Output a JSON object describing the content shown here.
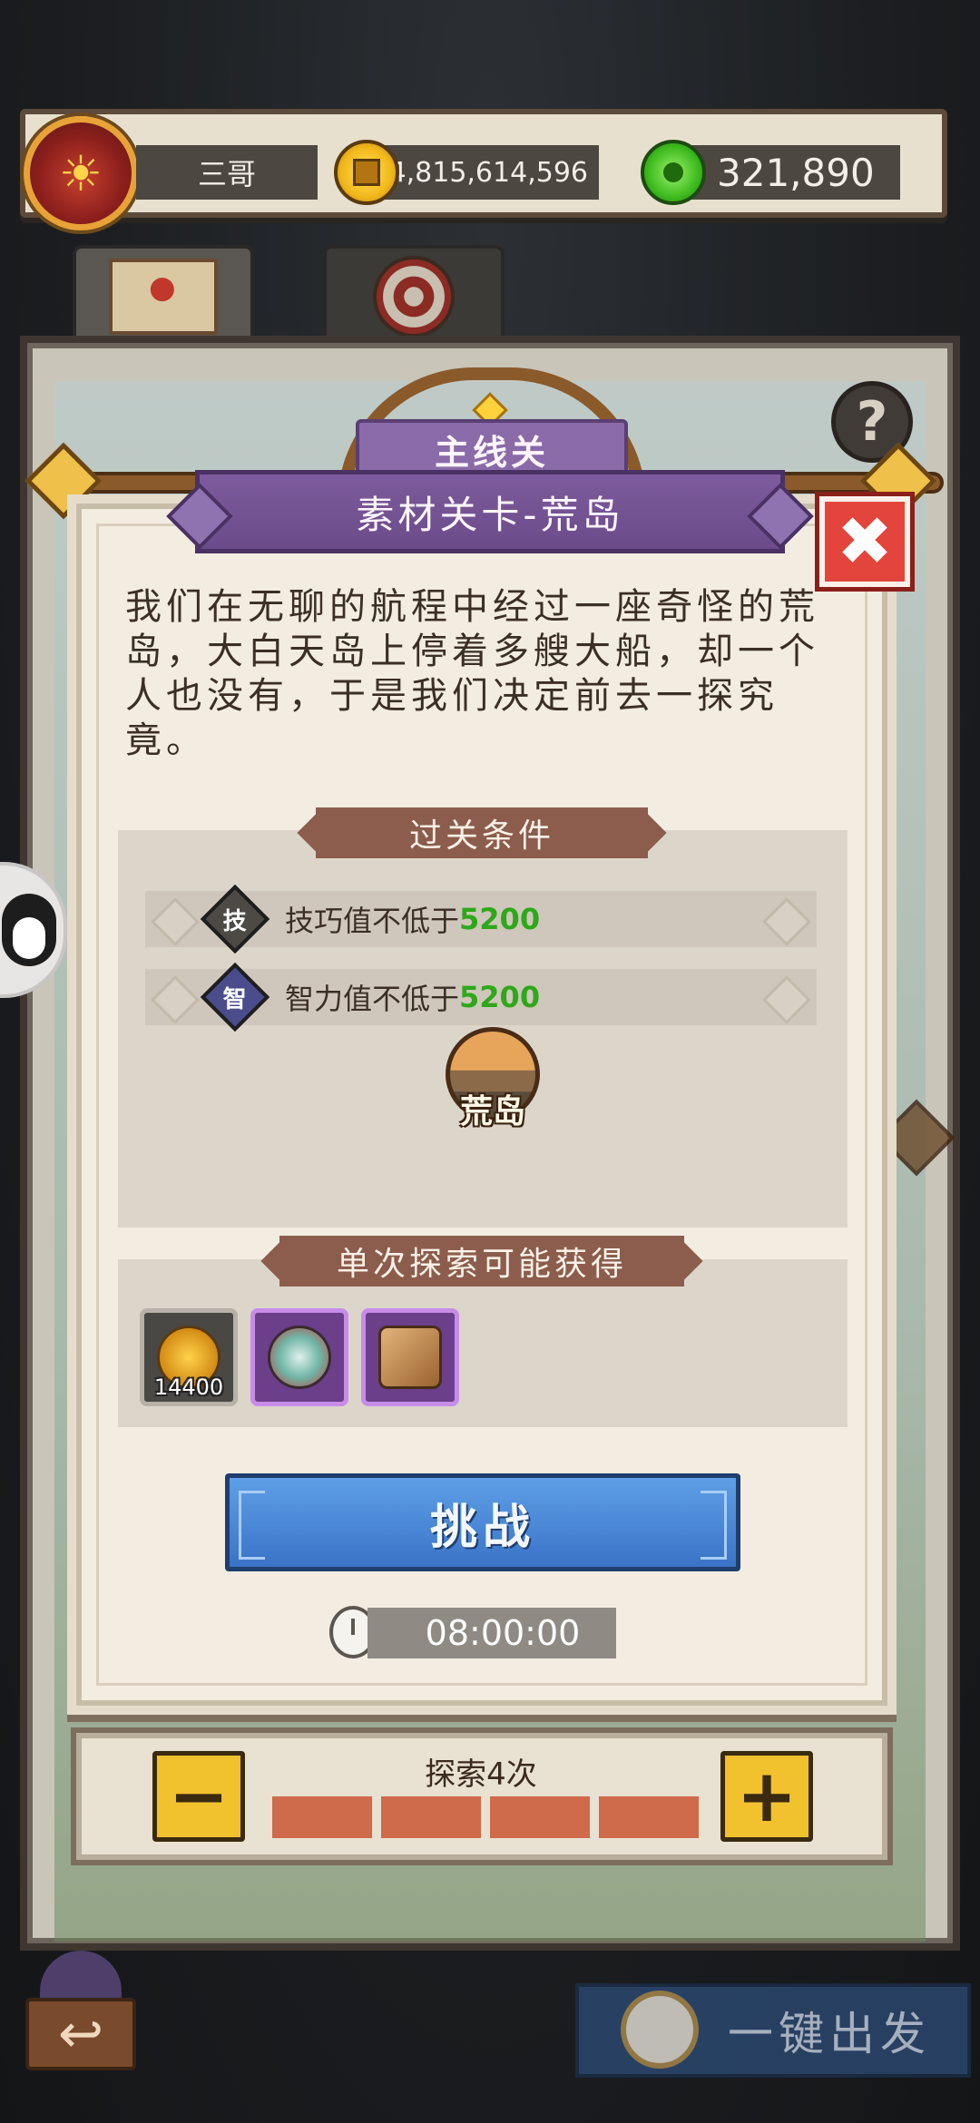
{
  "header": {
    "player_name": "三哥",
    "gold": "4,815,614,596",
    "jade": "321,890"
  },
  "dialog": {
    "category": "主线关",
    "title": "素材关卡-荒岛",
    "close_label": "✖",
    "description": "我们在无聊的航程中经过一座奇怪的荒岛，大白天岛上停着多艘大船，却一个人也没有，于是我们决定前去一探究竟。",
    "conditions_title": "过关条件",
    "conditions": [
      {
        "badge": "技",
        "text": "技巧值不低于",
        "value": "5200"
      },
      {
        "badge": "智",
        "text": "智力值不低于",
        "value": "5200"
      }
    ],
    "location_label": "荒岛",
    "rewards_title": "单次探索可能获得",
    "rewards": [
      {
        "icon": "gold-coins-icon",
        "count": "14400"
      },
      {
        "icon": "hot-air-balloon-icon",
        "count": ""
      },
      {
        "icon": "treasure-box-icon",
        "count": ""
      }
    ],
    "challenge_label": "挑战",
    "timer": "08:00:00"
  },
  "explore": {
    "label": "探索4次",
    "minus": "−",
    "plus": "+",
    "filled_segments": 4,
    "total_segments": 4
  },
  "footer": {
    "back_icon": "↩",
    "go_label": "一键出发"
  },
  "help_label": "?",
  "colors": {
    "accent_purple": "#7d5b9c",
    "challenge_blue": "#3a73c7",
    "condition_green": "#2ea81a",
    "close_red": "#e3453c",
    "step_yellow": "#f2c12e"
  }
}
